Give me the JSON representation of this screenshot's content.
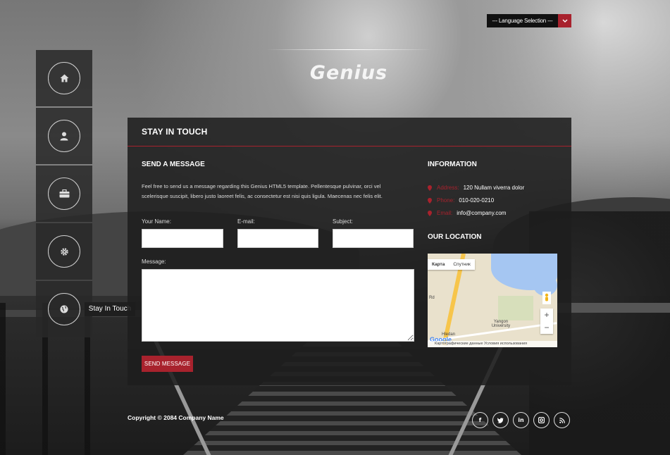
{
  "language": {
    "selected": "--- Language Selection ---"
  },
  "brand": {
    "logo": "Genius"
  },
  "sidebar": {
    "items": [
      {
        "icon": "home-icon"
      },
      {
        "icon": "user-icon"
      },
      {
        "icon": "briefcase-icon"
      },
      {
        "icon": "gear-icon"
      },
      {
        "icon": "globe-icon"
      }
    ],
    "tooltip": "Stay In Touch"
  },
  "panel": {
    "title": "STAY IN TOUCH",
    "message_section": {
      "title": "SEND A MESSAGE",
      "intro": "Feel free to send us a message regarding this Genius HTML5 template. Pellentesque pulvinar, orci vel scelerisque suscipit, libero justo laoreet felis, ac consectetur est nisi quis ligula. Maecenas nec felis elit.",
      "name_label": "Your Name:",
      "email_label": "E-mail:",
      "subject_label": "Subject:",
      "message_label": "Message:",
      "name_value": "",
      "email_value": "",
      "subject_value": "",
      "message_value": "",
      "send_label": "SEND MESSAGE"
    },
    "info_section": {
      "title": "INFORMATION",
      "address_label": "Address:",
      "address_value": "120 Nullam viverra dolor",
      "phone_label": "Phone:",
      "phone_value": "010-020-0210",
      "email_label": "Email:",
      "email_value": "info@company.com"
    },
    "location_section": {
      "title": "OUR LOCATION",
      "map_tab_map": "Карта",
      "map_tab_satellite": "Спутник",
      "map_zoom_in": "+",
      "map_zoom_out": "−",
      "map_label_university": "Yangon University",
      "map_label_hledan": "Hledan",
      "map_label_rd": "Rd",
      "map_logo": "Google",
      "map_footer": "Картографические данные   Условия использования"
    }
  },
  "footer": {
    "copyright": "Copyright © 2084 Company Name",
    "socials": [
      {
        "icon": "facebook-icon",
        "glyph": "f"
      },
      {
        "icon": "twitter-icon",
        "glyph": "t"
      },
      {
        "icon": "linkedin-icon",
        "glyph": "in"
      },
      {
        "icon": "instagram-icon",
        "glyph": "◘"
      },
      {
        "icon": "rss-icon",
        "glyph": "◉"
      }
    ]
  },
  "colors": {
    "accent": "#a8222d",
    "panel": "#1e1e1e"
  }
}
